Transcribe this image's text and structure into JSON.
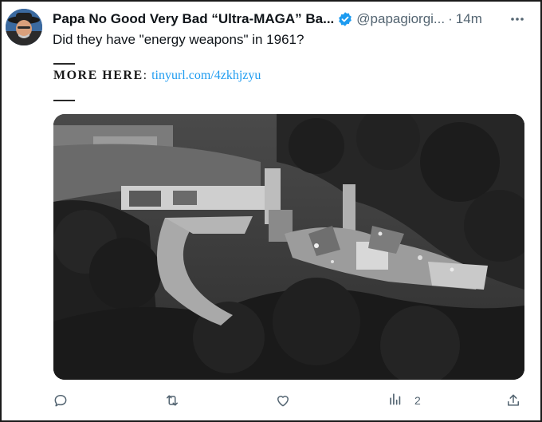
{
  "tweet": {
    "author_name": "Papa No Good Very Bad “Ultra-MAGA” Ba...",
    "handle": "@papagiorgi...",
    "separator": "·",
    "time": "14m",
    "text": "Did they have \"energy weapons\" in 1961?",
    "more_label": "MORE HERE",
    "more_colon": ":",
    "link": "tinyurl.com/4zkhjzyu",
    "image": "grayscale aerial photo of a burned-down house on a wooded hillside"
  },
  "icons": {
    "avatar": "avatar",
    "verified": "verified-badge-icon",
    "more": "more-icon",
    "reply": "reply-icon",
    "retweet": "retweet-icon",
    "like": "like-icon",
    "views": "views-icon",
    "share": "share-icon"
  },
  "actions": {
    "views_count": "2"
  },
  "colors": {
    "accent": "#1d9bf0",
    "secondary_text": "#536471",
    "border": "#1b1b1b"
  }
}
